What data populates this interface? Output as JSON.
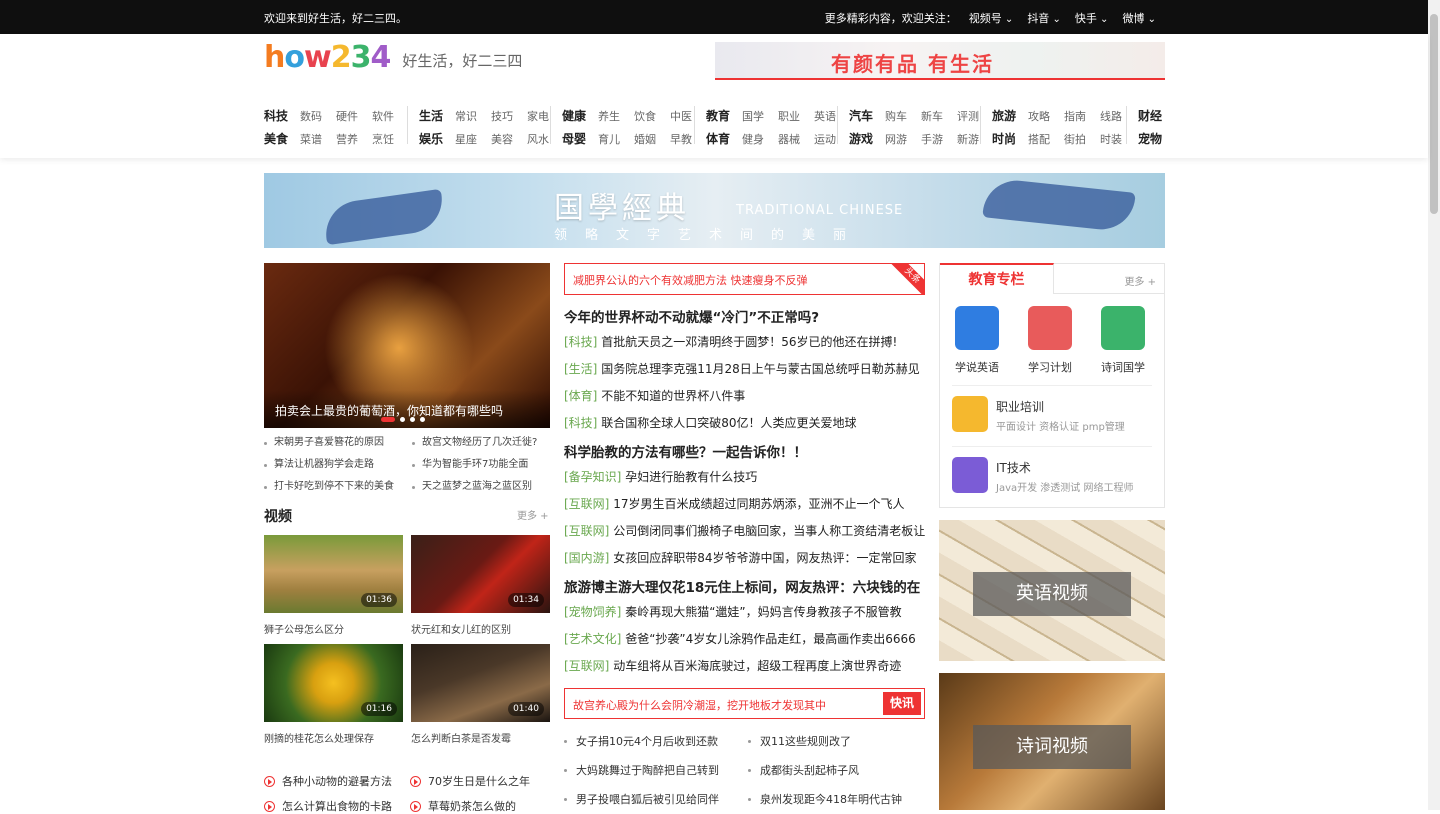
{
  "topbar": {
    "welcome": "欢迎来到好生活，好二三四。",
    "follow_label": "更多精彩内容，欢迎关注：",
    "links": [
      "视频号",
      "抖音",
      "快手",
      "微博"
    ]
  },
  "header": {
    "logo_text": "HOW234",
    "tagline": "好生活，好二三四",
    "ad_text": "有颜有品 有生活"
  },
  "nav": [
    {
      "rows": [
        [
          "科技",
          "数码",
          "硬件",
          "软件"
        ],
        [
          "美食",
          "菜谱",
          "营养",
          "烹饪"
        ]
      ]
    },
    {
      "rows": [
        [
          "生活",
          "常识",
          "技巧",
          "家电"
        ],
        [
          "娱乐",
          "星座",
          "美容",
          "风水"
        ]
      ]
    },
    {
      "rows": [
        [
          "健康",
          "养生",
          "饮食",
          "中医"
        ],
        [
          "母婴",
          "育儿",
          "婚姻",
          "早教"
        ]
      ]
    },
    {
      "rows": [
        [
          "教育",
          "国学",
          "职业",
          "英语"
        ],
        [
          "体育",
          "健身",
          "器械",
          "运动"
        ]
      ]
    },
    {
      "rows": [
        [
          "汽车",
          "购车",
          "新车",
          "评测"
        ],
        [
          "游戏",
          "网游",
          "手游",
          "新游"
        ]
      ]
    },
    {
      "rows": [
        [
          "旅游",
          "攻略",
          "指南",
          "线路"
        ],
        [
          "时尚",
          "搭配",
          "街拍",
          "时装"
        ]
      ]
    },
    {
      "rows": [
        [
          "财经"
        ],
        [
          "宠物"
        ]
      ]
    }
  ],
  "banner": {
    "title": "国學經典",
    "en": "TRADITIONAL CHINESE",
    "sub": "领略文字艺术间的美丽"
  },
  "slider": {
    "caption": "拍卖会上最贵的葡萄酒，你知道都有哪些吗"
  },
  "left_list": [
    [
      "宋朝男子喜爱簪花的原因",
      "故宫文物经历了几次迁徙?"
    ],
    [
      "算法让机器狗学会走路",
      "华为智能手环7功能全面"
    ],
    [
      "打卡好吃到停不下来的美食",
      "天之蓝梦之蓝海之蓝区别"
    ]
  ],
  "video": {
    "title": "视频",
    "more": "更多 +",
    "items": [
      {
        "caption": "狮子公母怎么区分",
        "duration": "01:36"
      },
      {
        "caption": "状元红和女儿红的区别",
        "duration": "01:34"
      },
      {
        "caption": "刚摘的桂花怎么处理保存",
        "duration": "01:16"
      },
      {
        "caption": "怎么判断白茶是否发霉",
        "duration": "01:40"
      }
    ],
    "playlist": [
      [
        "各种小动物的避暑方法",
        "70岁生日是什么之年"
      ],
      [
        "怎么计算出食物的卡路",
        "草莓奶茶怎么做的"
      ]
    ]
  },
  "center": {
    "headline": "减肥界公认的六个有效减肥方法 快速瘦身不反弹",
    "headline_badge": "头条",
    "news": [
      {
        "big": true,
        "text": "今年的世界杯动不动就爆“冷门”不正常吗?"
      },
      {
        "tag": "[科技]",
        "text": "首批航天员之一邓清明终于圆梦！56岁已的他还在拼搏!"
      },
      {
        "tag": "[生活]",
        "text": "国务院总理李克强11月28日上午与蒙古国总统呼日勒苏赫见"
      },
      {
        "tag": "[体育]",
        "text": "不能不知道的世界杯八件事"
      },
      {
        "tag": "[科技]",
        "text": "联合国称全球人口突破80亿！人类应更关爱地球"
      },
      {
        "big": true,
        "text": "科学胎教的方法有哪些？一起告诉你！！"
      },
      {
        "tag": "[备孕知识]",
        "text": "孕妇进行胎教有什么技巧"
      },
      {
        "tag": "[互联网]",
        "text": "17岁男生百米成绩超过同期苏炳添，亚洲不止一个飞人"
      },
      {
        "tag": "[互联网]",
        "text": "公司倒闭同事们搬椅子电脑回家，当事人称工资结清老板让"
      },
      {
        "tag": "[国内游]",
        "text": "女孩回应辞职带84岁爷爷游中国，网友热评：一定常回家"
      },
      {
        "big": true,
        "text": "旅游博主游大理仅花18元住上标间，网友热评：六块钱的在"
      },
      {
        "tag": "[宠物饲养]",
        "text": "秦岭再现大熊猫“邋娃”，妈妈言传身教孩子不服管教"
      },
      {
        "tag": "[艺术文化]",
        "text": "爸爸“抄袭”4岁女儿涂鸦作品走红，最高画作卖出6666"
      },
      {
        "tag": "[互联网]",
        "text": "动车组将从百米海底驶过，超级工程再度上演世界奇迹"
      }
    ],
    "flash": "故宫养心殿为什么会阴冷潮湿，挖开地板才发现其中",
    "flash_badge": "快讯",
    "flash_list": [
      [
        "女子捐10元4个月后收到还款",
        "双11这些规则改了"
      ],
      [
        "大妈跳舞过于陶醉把自己转到",
        "成都街头刮起柿子风"
      ],
      [
        "男子投喂白狐后被引见给同伴",
        "泉州发现距今418年明代古钟"
      ]
    ]
  },
  "edu": {
    "title": "教育专栏",
    "more": "更多 +",
    "apps": [
      {
        "label": "学说英语",
        "color": "#2f7de1"
      },
      {
        "label": "学习计划",
        "color": "#e85b5b"
      },
      {
        "label": "诗词国学",
        "color": "#3bb36b"
      }
    ],
    "rows": [
      {
        "title": "职业培训",
        "desc": "平面设计    资格认证    pmp管理",
        "color": "#f5b82e"
      },
      {
        "title": "IT技术",
        "desc": "Java开发    渗透测试    网络工程师",
        "color": "#7b5cd6"
      }
    ]
  },
  "side_videos": [
    {
      "label": "英语视频"
    },
    {
      "label": "诗词视频"
    }
  ]
}
